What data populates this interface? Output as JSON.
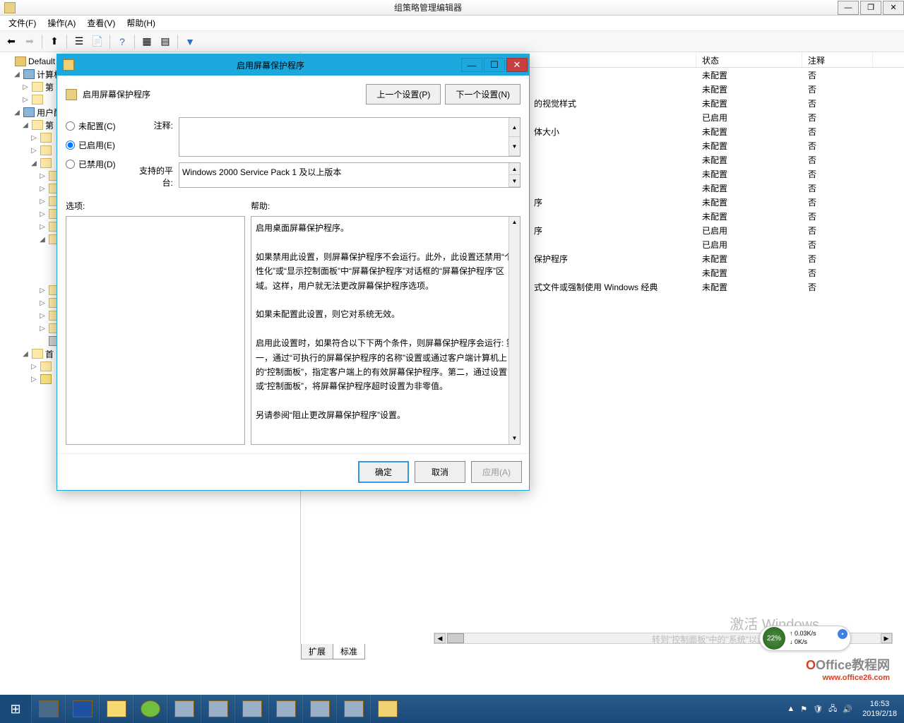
{
  "window": {
    "title": "组策略管理编辑器",
    "minimize": "—",
    "maximize": "❐",
    "close": "✕"
  },
  "menu": {
    "file": "文件(F)",
    "action": "操作(A)",
    "view": "查看(V)",
    "help": "帮助(H)"
  },
  "tree": {
    "root": "Default D",
    "computer": "计算机",
    "node1": "第",
    "user": "用户配",
    "node2": "第",
    "pref": "首"
  },
  "list": {
    "headers": {
      "state": "状态",
      "note": "注释"
    },
    "rows": [
      {
        "name": "",
        "state": "未配置",
        "note": "否"
      },
      {
        "name": "",
        "state": "未配置",
        "note": "否"
      },
      {
        "name": "的视觉样式",
        "state": "未配置",
        "note": "否"
      },
      {
        "name": "",
        "state": "已启用",
        "note": "否"
      },
      {
        "name": "体大小",
        "state": "未配置",
        "note": "否"
      },
      {
        "name": "",
        "state": "未配置",
        "note": "否"
      },
      {
        "name": "",
        "state": "未配置",
        "note": "否"
      },
      {
        "name": "",
        "state": "未配置",
        "note": "否"
      },
      {
        "name": "",
        "state": "未配置",
        "note": "否"
      },
      {
        "name": "序",
        "state": "未配置",
        "note": "否"
      },
      {
        "name": "",
        "state": "未配置",
        "note": "否"
      },
      {
        "name": "序",
        "state": "已启用",
        "note": "否"
      },
      {
        "name": "",
        "state": "已启用",
        "note": "否"
      },
      {
        "name": "保护程序",
        "state": "未配置",
        "note": "否"
      },
      {
        "name": "",
        "state": "未配置",
        "note": "否"
      },
      {
        "name": "式文件或强制使用 Windows 经典",
        "state": "未配置",
        "note": "否"
      }
    ]
  },
  "tabs": {
    "extended": "扩展",
    "standard": "标准"
  },
  "dialog": {
    "title": "启用屏幕保护程序",
    "heading": "启用屏幕保护程序",
    "prev": "上一个设置(P)",
    "next": "下一个设置(N)",
    "radio_unconf": "未配置(C)",
    "radio_enabled": "已启用(E)",
    "radio_disabled": "已禁用(D)",
    "label_note": "注释:",
    "label_platform": "支持的平台:",
    "platform_text": "Windows 2000 Service Pack 1 及以上版本",
    "label_options": "选项:",
    "label_help": "帮助:",
    "help_p1": "启用桌面屏幕保护程序。",
    "help_p2": "如果禁用此设置，则屏幕保护程序不会运行。此外，此设置还禁用“个性化”或“显示控制面板”中“屏幕保护程序”对话框的“屏幕保护程序”区域。这样，用户就无法更改屏幕保护程序选项。",
    "help_p3": "如果未配置此设置，则它对系统无效。",
    "help_p4": "启用此设置时，如果符合以下下两个条件，则屏幕保护程序会运行: 第一，通过“可执行的屏幕保护程序的名称”设置或通过客户端计算机上的“控制面板”，指定客户端上的有效屏幕保护程序。第二，通过设置或“控制面板”，将屏幕保护程序超时设置为非零值。",
    "help_p5": "另请参阅“阻止更改屏幕保护程序”设置。",
    "ok": "确定",
    "cancel": "取消",
    "apply": "应用(A)"
  },
  "activate": {
    "title": "激活 Windows",
    "sub": "转到\"控制面板\"中的\"系统\"以激活 Windows。"
  },
  "speed": {
    "pct": "22%",
    "up": "↑ 0.03K/s",
    "down": "↓ 0K/s"
  },
  "watermark": {
    "o": "O",
    "t": "Office教程网",
    "url": "www.office26.com"
  },
  "clock": {
    "time": "16:53",
    "date": "2019/2/18"
  }
}
